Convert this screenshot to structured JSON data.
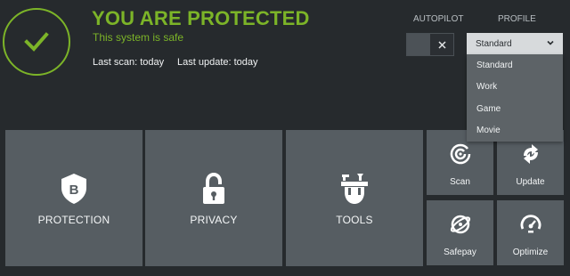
{
  "header": {
    "status_title": "YOU ARE PROTECTED",
    "status_subtitle": "This system is safe",
    "last_scan": "Last scan: today",
    "last_update": "Last update: today"
  },
  "controls": {
    "autopilot_label": "AUTOPILOT",
    "profile_label": "PROFILE",
    "autopilot_state": "off",
    "profile_selected": "Standard",
    "profile_options": [
      "Standard",
      "Work",
      "Game",
      "Movie"
    ]
  },
  "tiles": {
    "protection": "PROTECTION",
    "privacy": "PRIVACY",
    "tools": "TOOLS",
    "scan": "Scan",
    "update": "Update",
    "safepay": "Safepay",
    "optimize": "Optimize"
  },
  "colors": {
    "background": "#262a2d",
    "accent_green": "#7cb428",
    "tile": "#565d62",
    "dropdown_menu": "#5d6367"
  },
  "icons": {
    "status": "checkmark-icon",
    "protection": "shield-b-icon",
    "privacy": "padlock-icon",
    "tools": "toolbelt-icon",
    "scan": "scan-icon",
    "update": "refresh-arrows-icon",
    "safepay": "safepay-globe-icon",
    "optimize": "speedometer-icon",
    "toggle_off": "close-icon",
    "dropdown": "chevron-down-icon"
  }
}
